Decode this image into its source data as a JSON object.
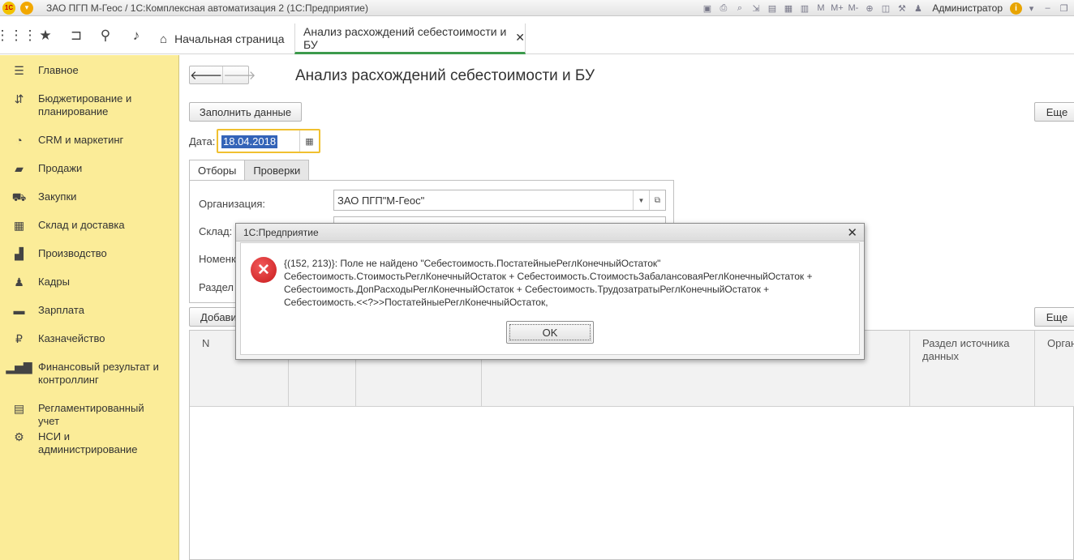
{
  "titlebar": {
    "logo": "1С",
    "title": "ЗАО ПГП М-Геос / 1С:Комплексная автоматизация 2  (1С:Предприятие)",
    "m_label": "M",
    "m_plus": "M+",
    "m_minus": "M-",
    "user": "Администратор",
    "info": "i"
  },
  "toppanel": {
    "tab_home": "Начальная страница",
    "tab_active": "Анализ расхождений себестоимости и БУ"
  },
  "sidebar": {
    "items": [
      {
        "label": "Главное",
        "icon": "menu-icon"
      },
      {
        "label": "Бюджетирование и планирование",
        "icon": "budget-icon"
      },
      {
        "label": "CRM и маркетинг",
        "icon": "crm-icon"
      },
      {
        "label": "Продажи",
        "icon": "sales-icon"
      },
      {
        "label": "Закупки",
        "icon": "cart-icon"
      },
      {
        "label": "Склад и доставка",
        "icon": "warehouse-icon"
      },
      {
        "label": "Производство",
        "icon": "factory-icon"
      },
      {
        "label": "Кадры",
        "icon": "person-icon"
      },
      {
        "label": "Зарплата",
        "icon": "salary-icon"
      },
      {
        "label": "Казначейство",
        "icon": "ruble-icon"
      },
      {
        "label": "Финансовый результат и контроллинг",
        "icon": "chart-icon"
      },
      {
        "label": "Регламентированный учет",
        "icon": "accounting-icon"
      },
      {
        "label": "НСИ и администрирование",
        "icon": "gear-icon"
      }
    ]
  },
  "form": {
    "title": "Анализ расхождений себестоимости и БУ",
    "fill_button": "Заполнить данные",
    "more_button": "Еще",
    "date_label": "Дата:",
    "date_value": "18.04.2018",
    "tab_filters": "Отборы",
    "tab_checks": "Проверки",
    "org_label": "Организация:",
    "org_value": "ЗАО ПГП\"М-Геос\"",
    "warehouse_label": "Склад:",
    "nomenclature_label": "Номенк",
    "section_label": "Раздел",
    "add_button": "Добави",
    "table_more_button": "Еще",
    "columns": {
      "n": "N",
      "section_source": "Раздел источника данных",
      "org": "Орган"
    }
  },
  "dialog": {
    "title": "1С:Предприятие",
    "message_lines": [
      "{(152, 213)}: Поле не найдено \"Себестоимость.ПостатейныеРеглКонечныйОстаток\"",
      "Себестоимость.СтоимостьРеглКонечныйОстаток + Себестоимость.СтоимостьЗабалансоваяРеглКонечныйОстаток +",
      "Себестоимость.ДопРасходыРеглКонечныйОстаток + Себестоимость.ТрудозатратыРеглКонечныйОстаток +",
      "Себестоимость.<<?>>ПостатейныеРеглКонечныйОстаток,"
    ],
    "ok_label": "OK"
  }
}
